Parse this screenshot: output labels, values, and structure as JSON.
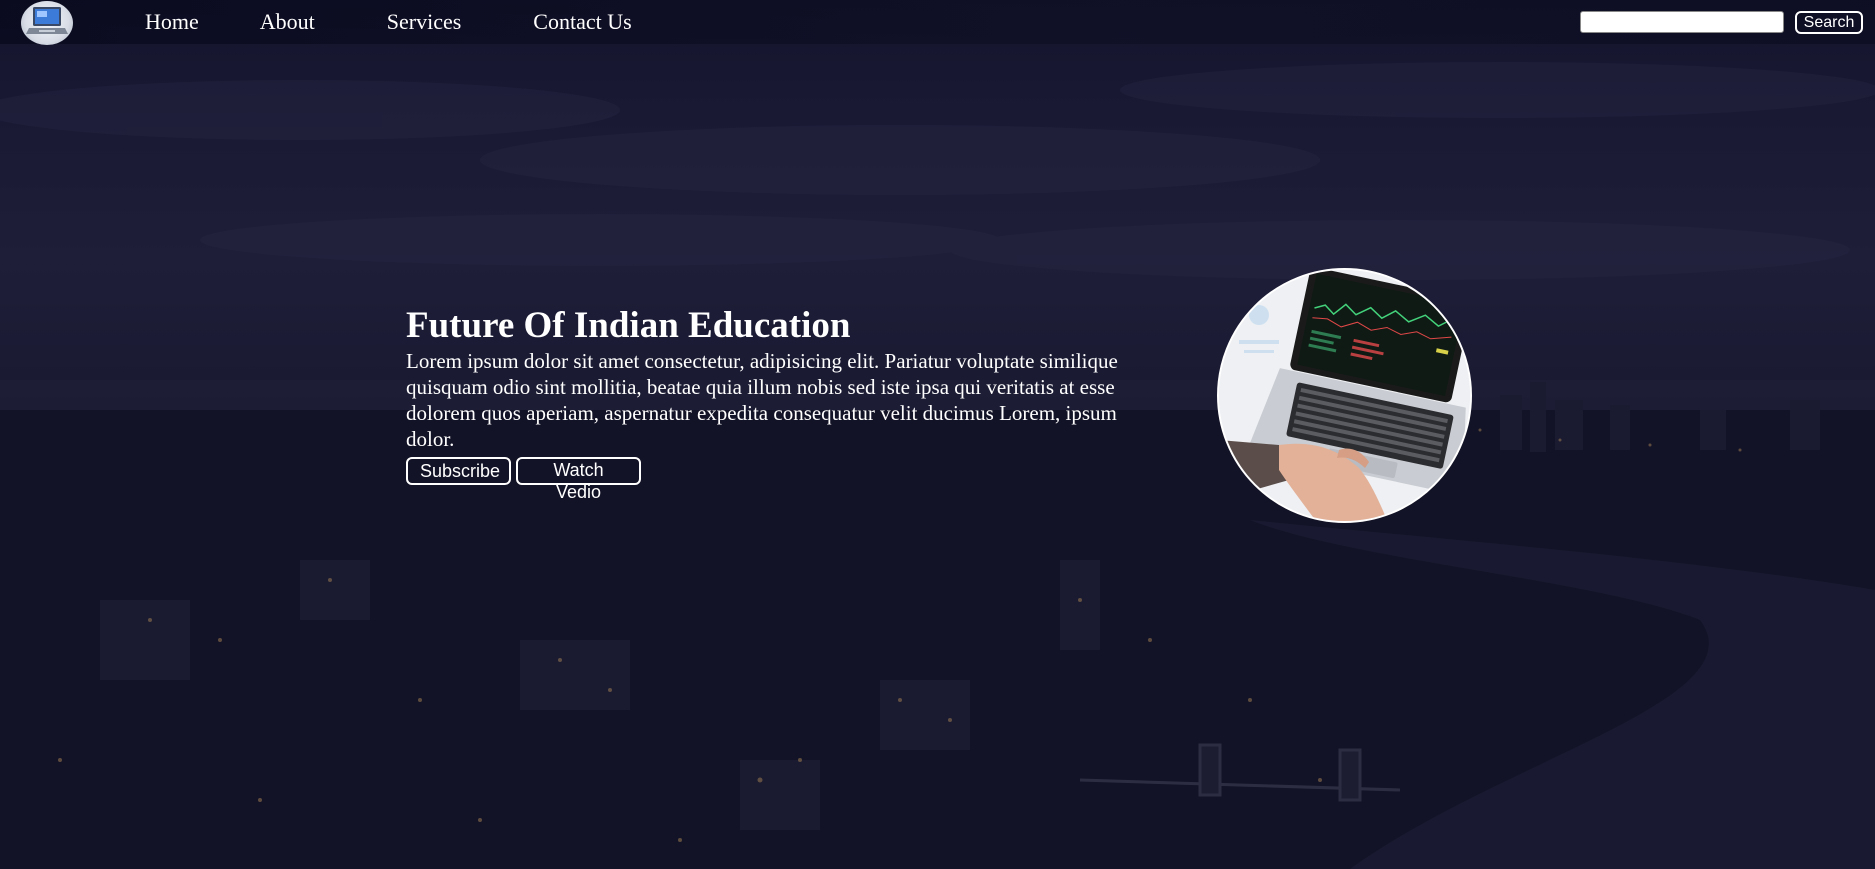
{
  "nav": {
    "logo_icon": "laptop-logo-icon",
    "links": [
      {
        "label": "Home"
      },
      {
        "label": "About"
      },
      {
        "label": "Services"
      },
      {
        "label": "Contact Us"
      }
    ],
    "search": {
      "placeholder": "",
      "value": "",
      "button_label": "Search"
    }
  },
  "hero": {
    "title": "Future Of Indian Education",
    "text": "Lorem ipsum dolor sit amet consectetur, adipisicing elit. Pariatur voluptate similique quisquam odio sint mollitia, beatae quia illum nobis sed iste ipsa qui veritatis at esse dolorem quos aperiam, aspernatur expedita consequatur velit ducimus Lorem, ipsum dolor.",
    "subscribe_label": "Subscribe",
    "watch_label": "Watch Vedio",
    "image_icon": "laptop-photo"
  },
  "colors": {
    "text": "#ffffff",
    "background": "#1b1b33",
    "accent": "#ffffff"
  }
}
